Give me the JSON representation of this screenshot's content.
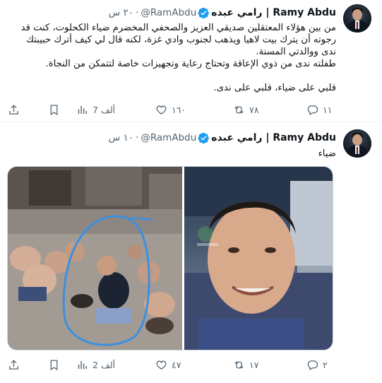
{
  "tweets": [
    {
      "name": "Ramy Abdu | رامي عبده",
      "handle": "@RamAbdu",
      "dot": "·",
      "time": "٢٠ س",
      "lines": [
        "من بين هؤلاء المعتقلين صديقي العزيز والصحفي المخضرم ضياء الكحلوت، كنت قد",
        "رجوته أن يترك بيت لاهيا ويذهب لجنوب وادي غزة، لكنه قال لي كيف أترك حبيبتك",
        "ندى ووالدتي المسنة.",
        "طفلته ندى من ذوي الإعاقة وتحتاج رعاية وتجهيزات خاصة لتتمكن من النجاة.",
        "",
        "قلبي على ضياء، قلبي على ندى."
      ],
      "replies": "١١",
      "retweets": "٧٨",
      "likes": "١٦٠",
      "views": "7 ألف"
    },
    {
      "name": "Ramy Abdu | رامي عبده",
      "handle": "@RamAbdu",
      "dot": "·",
      "time": "١٠ س",
      "lines": [
        "ضياء"
      ],
      "replies": "٢",
      "retweets": "١٧",
      "likes": "٤٧",
      "views": "2 ألف"
    }
  ],
  "colors": {
    "verified": "#1d9bf0",
    "muted": "#536471",
    "text": "#0f1419",
    "divider": "#eff3f4",
    "circle_annotation": "#3d8fe0"
  },
  "icons": [
    "reply-icon",
    "retweet-icon",
    "like-icon",
    "views-icon",
    "share-icon",
    "verified-badge-icon"
  ]
}
